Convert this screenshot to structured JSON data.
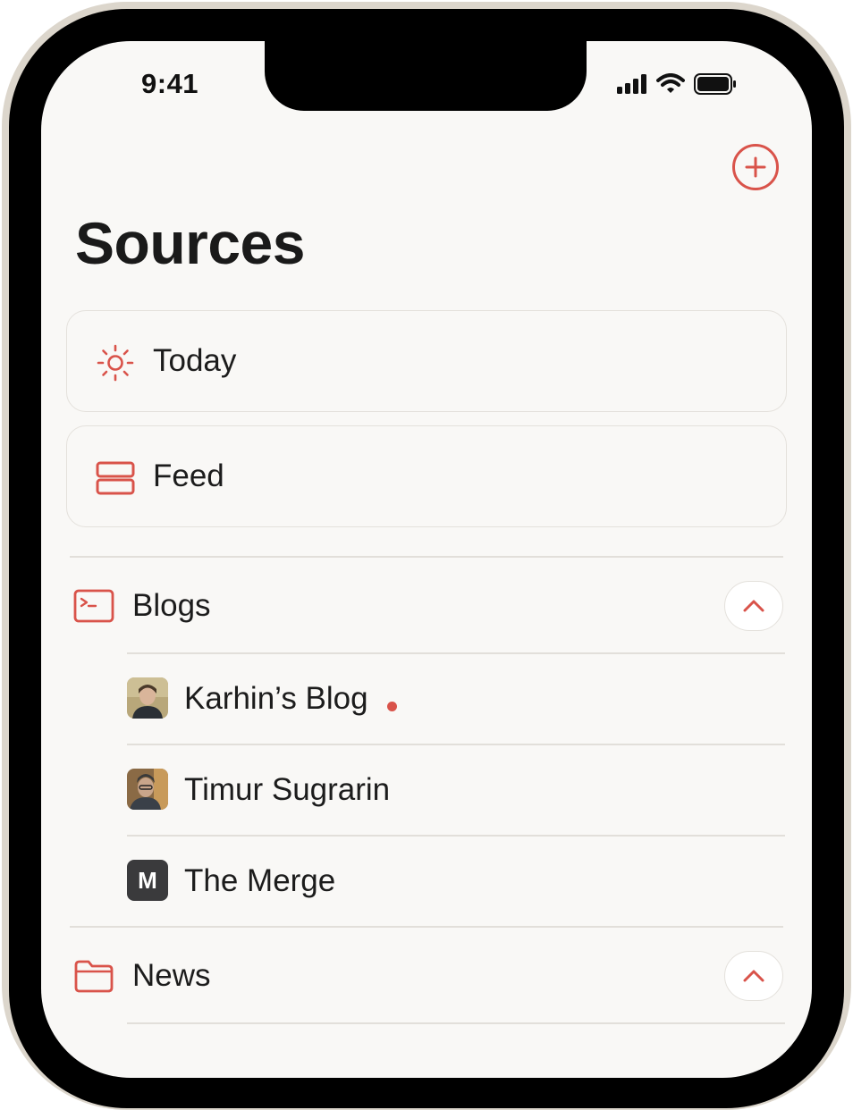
{
  "status_bar": {
    "time": "9:41"
  },
  "header": {
    "title": "Sources",
    "add_icon": "plus-circle-icon"
  },
  "shortcuts": [
    {
      "label": "Today",
      "icon": "sun-icon"
    },
    {
      "label": "Feed",
      "icon": "rows-icon"
    }
  ],
  "groups": [
    {
      "label": "Blogs",
      "icon": "terminal-window-icon",
      "expanded": true,
      "items": [
        {
          "label": "Karhin’s Blog",
          "avatar": "photo",
          "unread": true
        },
        {
          "label": "Timur Sugrarin",
          "avatar": "photo",
          "unread": false
        },
        {
          "label": "The Merge",
          "avatar_letter": "M",
          "unread": false
        }
      ]
    },
    {
      "label": "News",
      "icon": "folder-icon",
      "expanded": true,
      "items": []
    }
  ],
  "colors": {
    "accent": "#d9534a",
    "background": "#f9f8f6",
    "text": "#1c1c1c"
  }
}
